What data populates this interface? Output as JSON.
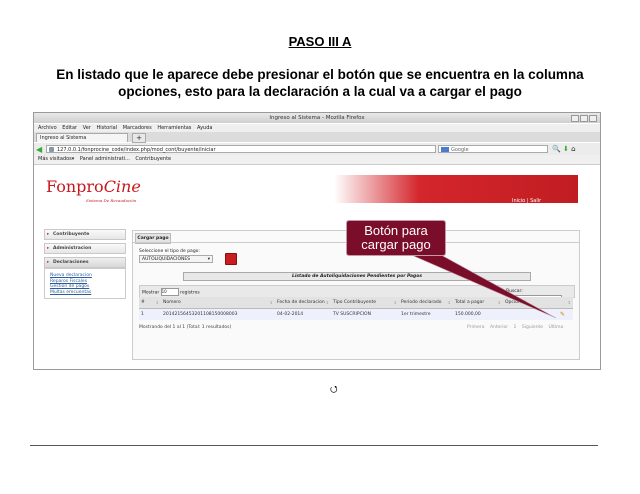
{
  "doc": {
    "title": "PASO III A",
    "instruction": "En listado que le aparece debe presionar el botón que se encuentra en la columna opciones, esto  para la declaración a la cual va a cargar el pago"
  },
  "browser": {
    "window_title": "Ingreso al Sistema - Mozilla Firefox",
    "menu": [
      "Archivo",
      "Editar",
      "Ver",
      "Historial",
      "Marcadores",
      "Herramientas",
      "Ayuda"
    ],
    "tab_label": "Ingreso al Sistema",
    "new_tab": "+",
    "url": "127.0.0.1/fonprocine_code/index.php/mod_cont/buyente/iniciar",
    "search_placeholder": "Google",
    "bookmarks": [
      "Más visitados▾",
      "Panel administrati...",
      "Contribuyente"
    ]
  },
  "site": {
    "logo_main": "Fonpro",
    "logo_italic": "Cine",
    "logo_sub": "Sistema De Recaudación",
    "header_links": "Inicio  |  Salir",
    "sidebar": [
      {
        "label": "Contribuyente"
      },
      {
        "label": "Administracion"
      },
      {
        "label": "Declaraciones"
      }
    ],
    "sidebar_sub": [
      "Nueva declaracion",
      "Reparos Fiscales",
      "Gestion de pagos",
      "Multas emcuentas"
    ],
    "panel_tab": "Cargar pago",
    "select_label": "Seleccione el tipo de pago:",
    "select_value": "AUTOLIQUIDACIONES",
    "list_title": "Listado de Autoliquidaciones Pendientes por Pagos",
    "show_prefix": "Mostrar",
    "show_value": "10",
    "show_suffix": "registros",
    "find_label": "Buscar:",
    "columns": [
      "#",
      "Nomero",
      "Fecha de declaracion",
      "Tipo Contribuyente",
      "Periodo declarado",
      "Total a pagar",
      "Opciones"
    ],
    "rows": [
      {
        "n": "1",
        "numero": "20142156453201108150008003",
        "fecha": "04-02-2014",
        "tipo": "TV SUSCRIPCION",
        "periodo": "1er trimestre",
        "total": "150.000,00"
      }
    ],
    "info": "Mostrando del 1 al 1 (Total: 1 resultados)",
    "pager": [
      "Primera",
      "Anterior",
      "1",
      "Siguiente",
      "Última"
    ]
  },
  "callout": "Botón para cargar pago",
  "colors": {
    "accent_red": "#c8181e",
    "callout_bg": "#7a0d2a"
  }
}
